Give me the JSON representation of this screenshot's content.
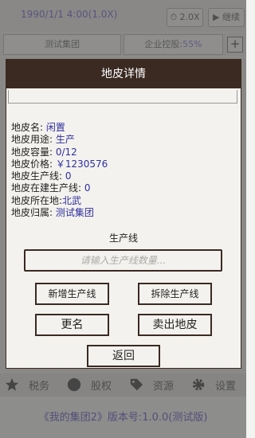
{
  "header": {
    "datetime_prefix": "1990/1/1 4:00",
    "datetime_speed": "(1.0X)",
    "speed_label": "2.0X",
    "continue_label": "继续"
  },
  "company_bar": {
    "company_name": "测试集团",
    "holding_label": "企业控股:",
    "holding_pct": "55%"
  },
  "bottom_nav": {
    "items": [
      {
        "label": "税务",
        "icon": "star-icon"
      },
      {
        "label": "股权",
        "icon": "circle-icon"
      },
      {
        "label": "资源",
        "icon": "tag-icon"
      },
      {
        "label": "设置",
        "icon": "gear-icon"
      }
    ]
  },
  "footer": {
    "text": "《我的集团2》版本号:1.0.0(测试版)"
  },
  "dialog": {
    "title": "地皮详情",
    "fields": [
      {
        "label": "地皮名: ",
        "value": "闲置"
      },
      {
        "label": "地皮用途: ",
        "value": "生产"
      },
      {
        "label": "地皮容量: ",
        "value": "0/12"
      },
      {
        "label": "地皮价格: ",
        "value": "￥1230576"
      },
      {
        "label": "地皮生产线: ",
        "value": "0"
      },
      {
        "label": "地皮在建生产线: ",
        "value": "0"
      },
      {
        "label": "地皮所在地:",
        "value": "北武"
      },
      {
        "label": "地皮归属: ",
        "value": "测试集团"
      }
    ],
    "section_title": "生产线",
    "input_placeholder": "请输入生产线数量...",
    "buttons": {
      "add_line": "新增生产线",
      "remove_line": "拆除生产线",
      "rename": "更名",
      "sell": "卖出地皮",
      "back": "返回"
    }
  },
  "colors": {
    "dialog_header": "#3a2a22",
    "value_text": "#2d2fa0",
    "footer_text": "#8d88cf"
  }
}
